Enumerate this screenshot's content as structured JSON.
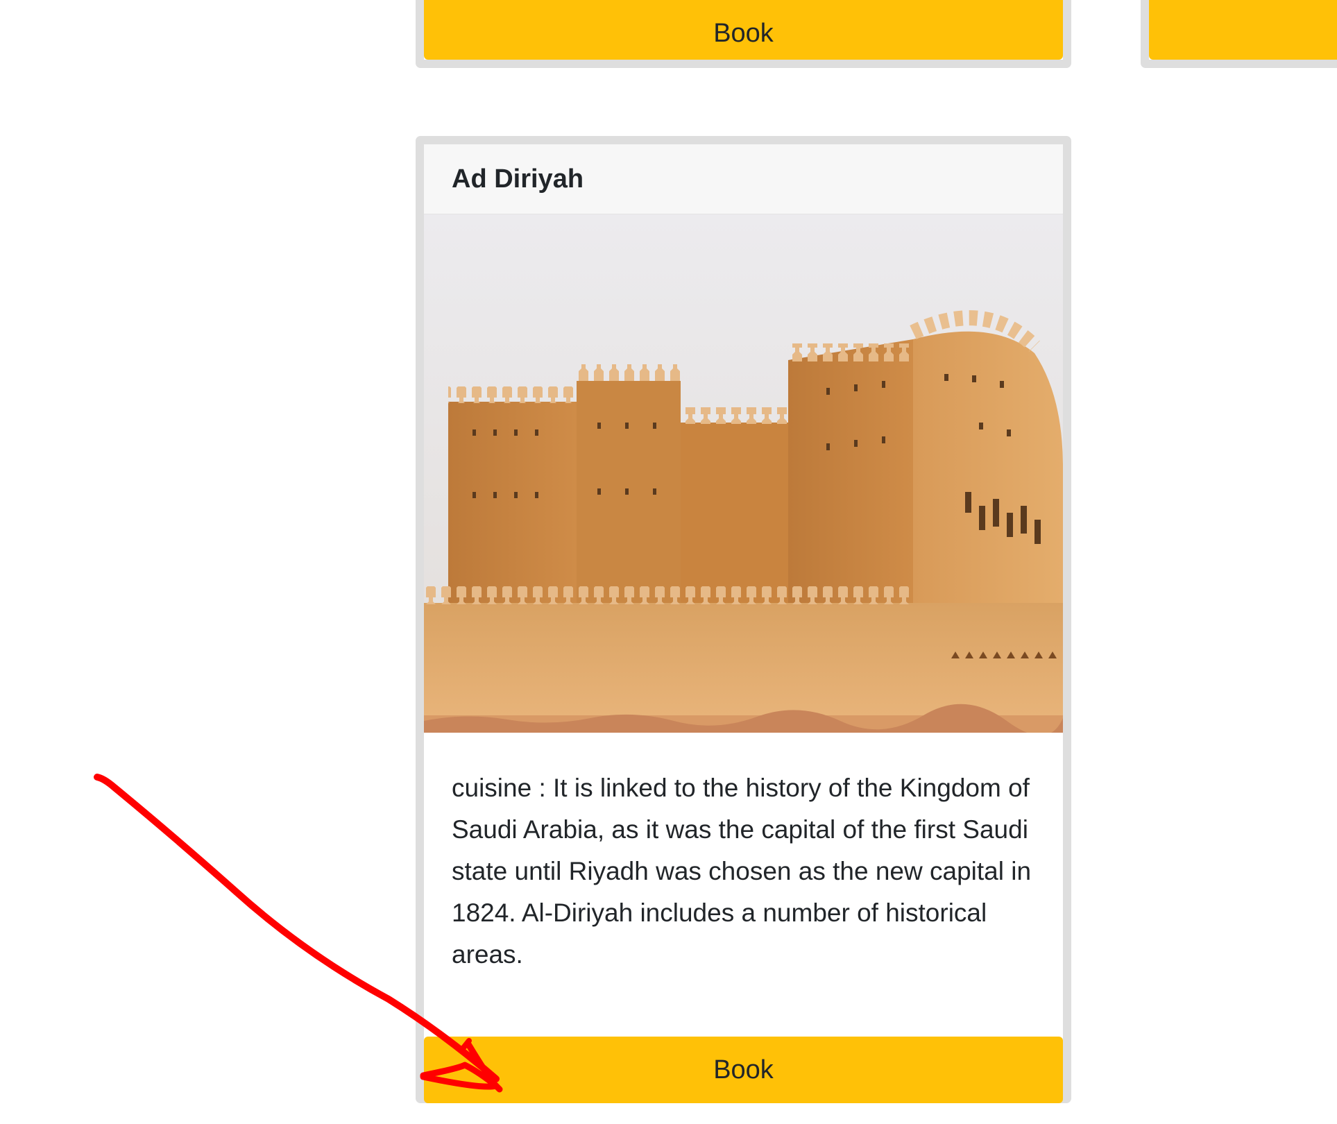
{
  "cards": {
    "top_left": {
      "book_label": "Book"
    },
    "top_right": {
      "book_label": ""
    },
    "main": {
      "title": "Ad Diriyah",
      "image_alt": "Ad Diriyah mud-brick fortress",
      "description": "cuisine : It is linked to the history of the Kingdom of Saudi Arabia, as it was the capital of the first Saudi state until Riyadh was chosen as the new capital in 1824. Al-Diriyah includes a number of historical areas.",
      "book_label": "Book"
    }
  },
  "colors": {
    "button": "#ffc107",
    "card_border": "#dedede",
    "header_bg": "#f7f7f7",
    "annotation_arrow": "#ff0000"
  },
  "annotation": {
    "icon": "hand-drawn-arrow-icon"
  }
}
